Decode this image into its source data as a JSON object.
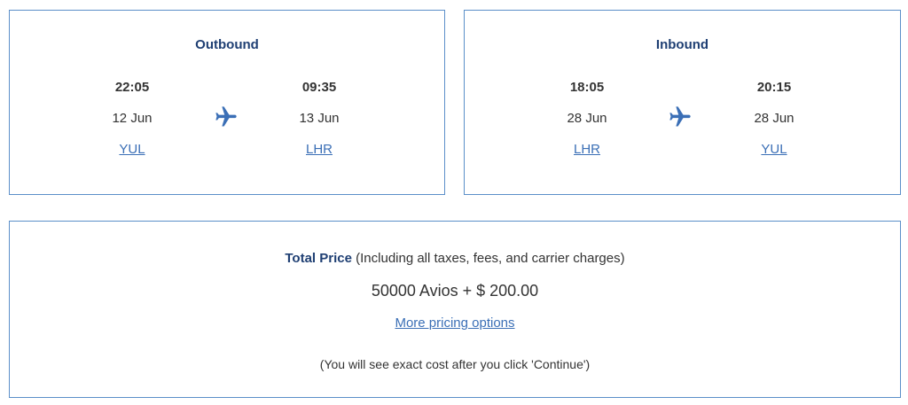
{
  "outbound": {
    "title": "Outbound",
    "departure": {
      "time": "22:05",
      "date": "12 Jun",
      "airport": "YUL"
    },
    "arrival": {
      "time": "09:35",
      "date": "13 Jun",
      "airport": "LHR"
    },
    "icon": "plane-icon"
  },
  "inbound": {
    "title": "Inbound",
    "departure": {
      "time": "18:05",
      "date": "28 Jun",
      "airport": "LHR"
    },
    "arrival": {
      "time": "20:15",
      "date": "28 Jun",
      "airport": "YUL"
    },
    "icon": "plane-icon"
  },
  "price": {
    "label": "Total Price",
    "label_note": " (Including all taxes, fees, and carrier charges)",
    "value": "50000 Avios + $ 200.00",
    "more_link": "More pricing options",
    "note": "(You will see exact cost after you click 'Continue')"
  },
  "colors": {
    "border": "#5b8fc9",
    "title": "#1f3f73",
    "link": "#3b6fb6",
    "icon": "#3b6fb6"
  }
}
